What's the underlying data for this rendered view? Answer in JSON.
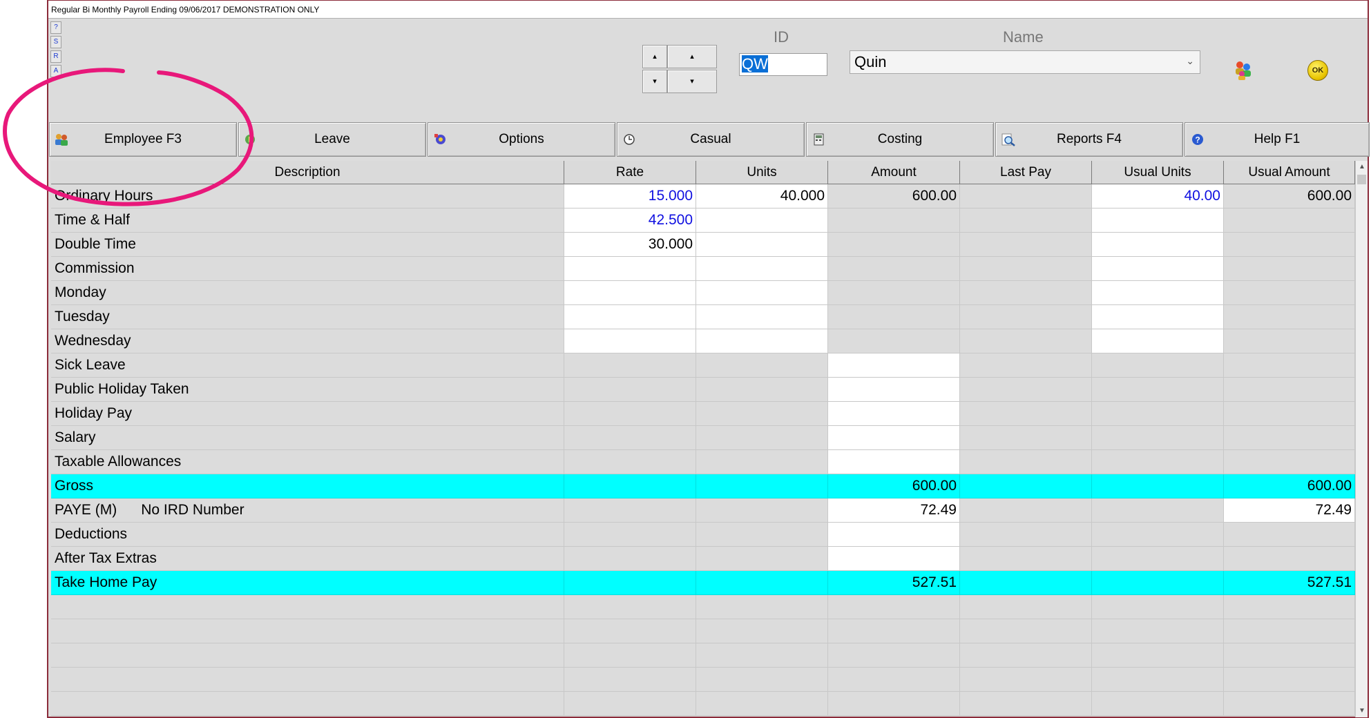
{
  "window": {
    "title": "Regular Bi Monthly Payroll Ending 09/06/2017 DEMONSTRATION ONLY"
  },
  "side_buttons": [
    "?",
    "S",
    "R",
    "A"
  ],
  "nav": {
    "up_small": "▴",
    "up": "▴",
    "down_small": "▾",
    "down": "▾"
  },
  "header": {
    "id_label": "ID",
    "id_value": "QW",
    "name_label": "Name",
    "name_value": "Quin",
    "ok_label": "OK"
  },
  "toolbar": [
    {
      "label": "Employee F3",
      "icon": "people-icon"
    },
    {
      "label": "Leave",
      "icon": "leave-icon"
    },
    {
      "label": "Options",
      "icon": "options-icon"
    },
    {
      "label": "Casual",
      "icon": "clock-icon"
    },
    {
      "label": "Costing",
      "icon": "calculator-icon"
    },
    {
      "label": "Reports F4",
      "icon": "magnifier-icon"
    },
    {
      "label": "Help F1",
      "icon": "help-icon"
    }
  ],
  "columns": [
    "Description",
    "Rate",
    "Units",
    "Amount",
    "Last Pay",
    "Usual Units",
    "Usual Amount"
  ],
  "rows": [
    {
      "desc": "Ordinary Hours",
      "rate": "15.000",
      "units": "40.000",
      "amount": "600.00",
      "last_pay": "",
      "usual_units": "40.00",
      "usual_amount": "600.00"
    },
    {
      "desc": "Time & Half",
      "rate": "42.500",
      "units": "",
      "amount": "",
      "last_pay": "",
      "usual_units": "",
      "usual_amount": ""
    },
    {
      "desc": "Double Time",
      "rate": "30.000",
      "units": "",
      "amount": "",
      "last_pay": "",
      "usual_units": "",
      "usual_amount": ""
    },
    {
      "desc": "Commission",
      "rate": "",
      "units": "",
      "amount": "",
      "last_pay": "",
      "usual_units": "",
      "usual_amount": ""
    },
    {
      "desc": "Monday",
      "rate": "",
      "units": "",
      "amount": "",
      "last_pay": "",
      "usual_units": "",
      "usual_amount": ""
    },
    {
      "desc": "Tuesday",
      "rate": "",
      "units": "",
      "amount": "",
      "last_pay": "",
      "usual_units": "",
      "usual_amount": ""
    },
    {
      "desc": "Wednesday",
      "rate": "",
      "units": "",
      "amount": "",
      "last_pay": "",
      "usual_units": "",
      "usual_amount": ""
    },
    {
      "desc": "Sick Leave",
      "rate": "",
      "units": "",
      "amount": "",
      "last_pay": "",
      "usual_units": "",
      "usual_amount": ""
    },
    {
      "desc": "Public Holiday Taken",
      "rate": "",
      "units": "",
      "amount": "",
      "last_pay": "",
      "usual_units": "",
      "usual_amount": ""
    },
    {
      "desc": "Holiday Pay",
      "rate": "",
      "units": "",
      "amount": "",
      "last_pay": "",
      "usual_units": "",
      "usual_amount": ""
    },
    {
      "desc": "Salary",
      "rate": "",
      "units": "",
      "amount": "",
      "last_pay": "",
      "usual_units": "",
      "usual_amount": ""
    },
    {
      "desc": "Taxable Allowances",
      "rate": "",
      "units": "",
      "amount": "",
      "last_pay": "",
      "usual_units": "",
      "usual_amount": ""
    },
    {
      "desc": "Gross",
      "rate": "",
      "units": "",
      "amount": "600.00",
      "last_pay": "",
      "usual_units": "",
      "usual_amount": "600.00"
    },
    {
      "desc": "PAYE (M)      No IRD Number",
      "rate": "",
      "units": "",
      "amount": "72.49",
      "last_pay": "",
      "usual_units": "",
      "usual_amount": "72.49"
    },
    {
      "desc": "Deductions",
      "rate": "",
      "units": "",
      "amount": "",
      "last_pay": "",
      "usual_units": "",
      "usual_amount": ""
    },
    {
      "desc": "After Tax Extras",
      "rate": "",
      "units": "",
      "amount": "",
      "last_pay": "",
      "usual_units": "",
      "usual_amount": ""
    },
    {
      "desc": "Take Home Pay",
      "rate": "",
      "units": "",
      "amount": "527.51",
      "last_pay": "",
      "usual_units": "",
      "usual_amount": "527.51"
    },
    {
      "desc": "",
      "rate": "",
      "units": "",
      "amount": "",
      "last_pay": "",
      "usual_units": "",
      "usual_amount": ""
    },
    {
      "desc": "",
      "rate": "",
      "units": "",
      "amount": "",
      "last_pay": "",
      "usual_units": "",
      "usual_amount": ""
    },
    {
      "desc": "",
      "rate": "",
      "units": "",
      "amount": "",
      "last_pay": "",
      "usual_units": "",
      "usual_amount": ""
    },
    {
      "desc": "",
      "rate": "",
      "units": "",
      "amount": "",
      "last_pay": "",
      "usual_units": "",
      "usual_amount": ""
    },
    {
      "desc": "",
      "rate": "",
      "units": "",
      "amount": "",
      "last_pay": "",
      "usual_units": "",
      "usual_amount": ""
    }
  ],
  "colors": {
    "highlight_row": "#00ffff",
    "editable_blue": "#1010e0",
    "annotation": "#e8187a"
  }
}
